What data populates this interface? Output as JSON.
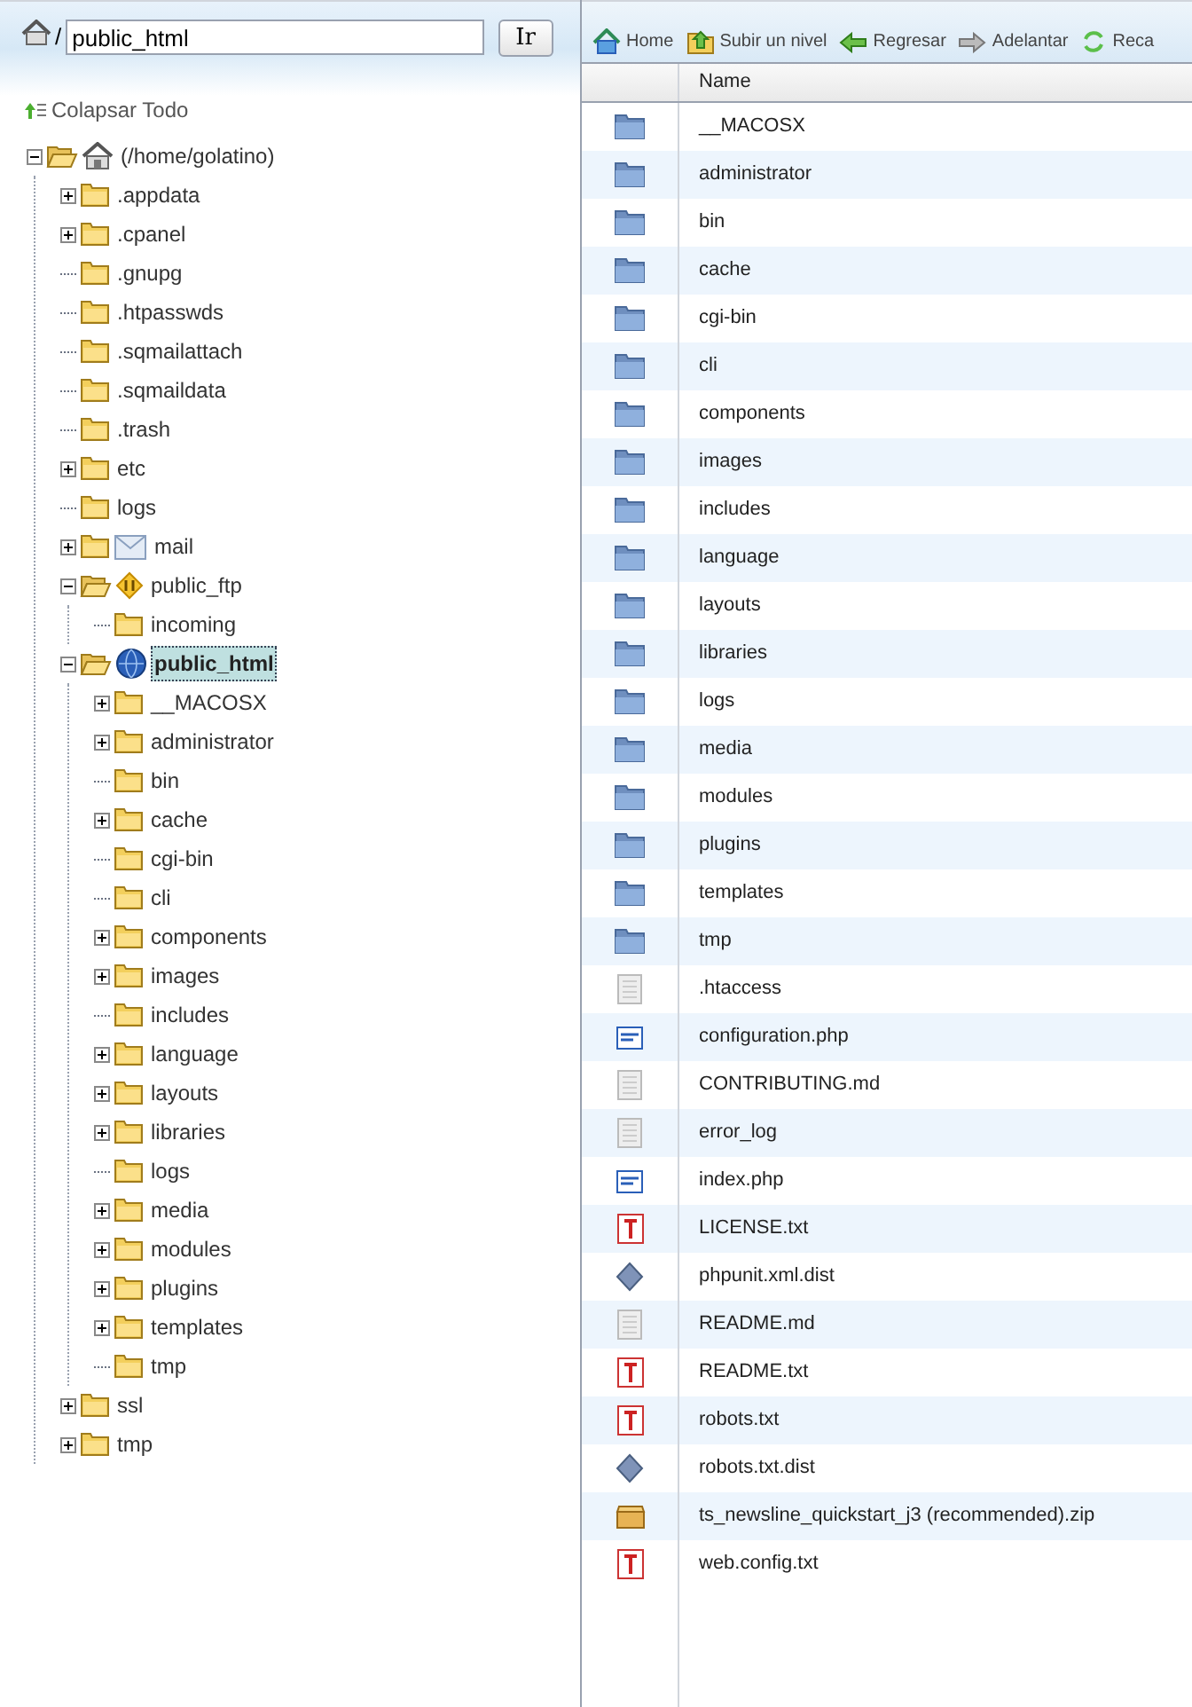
{
  "path_bar": {
    "separator": "/",
    "value": "public_html",
    "button": "Ir"
  },
  "collapse_all": "Colapsar Todo",
  "tree": {
    "label": "(/home/golatino)",
    "kind": "home",
    "expandable": true,
    "expanded": true,
    "selected": false,
    "children": [
      {
        "label": ".appdata",
        "expandable": true,
        "expanded": false,
        "selected": false
      },
      {
        "label": ".cpanel",
        "expandable": true,
        "expanded": false,
        "selected": false
      },
      {
        "label": ".gnupg",
        "expandable": false,
        "selected": false
      },
      {
        "label": ".htpasswds",
        "expandable": false,
        "selected": false
      },
      {
        "label": ".sqmailattach",
        "expandable": false,
        "selected": false
      },
      {
        "label": ".sqmaildata",
        "expandable": false,
        "selected": false
      },
      {
        "label": ".trash",
        "expandable": false,
        "selected": false
      },
      {
        "label": "etc",
        "expandable": true,
        "expanded": false,
        "selected": false
      },
      {
        "label": "logs",
        "expandable": false,
        "selected": false
      },
      {
        "label": "mail",
        "kind": "mail",
        "expandable": true,
        "expanded": false,
        "selected": false
      },
      {
        "label": "public_ftp",
        "kind": "ftp",
        "expandable": true,
        "expanded": true,
        "selected": false,
        "children": [
          {
            "label": "incoming",
            "expandable": false,
            "selected": false
          }
        ]
      },
      {
        "label": "public_html",
        "kind": "web",
        "expandable": true,
        "expanded": true,
        "selected": true,
        "children": [
          {
            "label": "__MACOSX",
            "expandable": true,
            "expanded": false,
            "selected": false
          },
          {
            "label": "administrator",
            "expandable": true,
            "expanded": false,
            "selected": false
          },
          {
            "label": "bin",
            "expandable": false,
            "selected": false
          },
          {
            "label": "cache",
            "expandable": true,
            "expanded": false,
            "selected": false
          },
          {
            "label": "cgi-bin",
            "expandable": false,
            "selected": false
          },
          {
            "label": "cli",
            "expandable": false,
            "selected": false
          },
          {
            "label": "components",
            "expandable": true,
            "expanded": false,
            "selected": false
          },
          {
            "label": "images",
            "expandable": true,
            "expanded": false,
            "selected": false
          },
          {
            "label": "includes",
            "expandable": false,
            "selected": false
          },
          {
            "label": "language",
            "expandable": true,
            "expanded": false,
            "selected": false
          },
          {
            "label": "layouts",
            "expandable": true,
            "expanded": false,
            "selected": false
          },
          {
            "label": "libraries",
            "expandable": true,
            "expanded": false,
            "selected": false
          },
          {
            "label": "logs",
            "expandable": false,
            "selected": false
          },
          {
            "label": "media",
            "expandable": true,
            "expanded": false,
            "selected": false
          },
          {
            "label": "modules",
            "expandable": true,
            "expanded": false,
            "selected": false
          },
          {
            "label": "plugins",
            "expandable": true,
            "expanded": false,
            "selected": false
          },
          {
            "label": "templates",
            "expandable": true,
            "expanded": false,
            "selected": false
          },
          {
            "label": "tmp",
            "expandable": false,
            "selected": false
          }
        ]
      },
      {
        "label": "ssl",
        "expandable": true,
        "expanded": false,
        "selected": false
      },
      {
        "label": "tmp",
        "expandable": true,
        "expanded": false,
        "selected": false
      }
    ]
  },
  "toolbar": [
    {
      "label": "Home",
      "kind": "home"
    },
    {
      "label": "Subir un nivel",
      "kind": "up"
    },
    {
      "label": "Regresar",
      "kind": "back"
    },
    {
      "label": "Adelantar",
      "kind": "forward"
    },
    {
      "label": "Reca",
      "kind": "reload"
    }
  ],
  "table": {
    "columns": [
      "Name"
    ],
    "rows": [
      {
        "name": "__MACOSX",
        "kind": "folder"
      },
      {
        "name": "administrator",
        "kind": "folder"
      },
      {
        "name": "bin",
        "kind": "folder"
      },
      {
        "name": "cache",
        "kind": "folder"
      },
      {
        "name": "cgi-bin",
        "kind": "folder"
      },
      {
        "name": "cli",
        "kind": "folder"
      },
      {
        "name": "components",
        "kind": "folder"
      },
      {
        "name": "images",
        "kind": "folder"
      },
      {
        "name": "includes",
        "kind": "folder"
      },
      {
        "name": "language",
        "kind": "folder"
      },
      {
        "name": "layouts",
        "kind": "folder"
      },
      {
        "name": "libraries",
        "kind": "folder"
      },
      {
        "name": "logs",
        "kind": "folder"
      },
      {
        "name": "media",
        "kind": "folder"
      },
      {
        "name": "modules",
        "kind": "folder"
      },
      {
        "name": "plugins",
        "kind": "folder"
      },
      {
        "name": "templates",
        "kind": "folder"
      },
      {
        "name": "tmp",
        "kind": "folder"
      },
      {
        "name": ".htaccess",
        "kind": "file"
      },
      {
        "name": "configuration.php",
        "kind": "php"
      },
      {
        "name": "CONTRIBUTING.md",
        "kind": "file"
      },
      {
        "name": "error_log",
        "kind": "file"
      },
      {
        "name": "index.php",
        "kind": "php"
      },
      {
        "name": "LICENSE.txt",
        "kind": "text"
      },
      {
        "name": "phpunit.xml.dist",
        "kind": "xml"
      },
      {
        "name": "README.md",
        "kind": "file"
      },
      {
        "name": "README.txt",
        "kind": "text"
      },
      {
        "name": "robots.txt",
        "kind": "text"
      },
      {
        "name": "robots.txt.dist",
        "kind": "xml"
      },
      {
        "name": "ts_newsline_quickstart_j3 (recommended).zip",
        "kind": "zip"
      },
      {
        "name": "web.config.txt",
        "kind": "text"
      }
    ]
  }
}
